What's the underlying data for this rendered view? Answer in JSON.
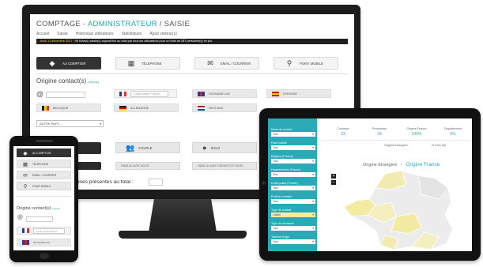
{
  "monitor": {
    "title_prefix": "COMPTAGE - ",
    "title_role": "ADMINISTRATEUR",
    "title_suffix": " / SAISIE",
    "nav": [
      "Accueil",
      "Saisie",
      "Historique utilisateurs",
      "Statistiques",
      "Ajout visiteur(s)"
    ],
    "alert_date": "Jeudi 11 décembre 2017",
    "alert_text": " : 96 fiche(s) saisie(s) aujourd'hui au total par tous les utilisateurs pour un total de 287 personne(s) en jeu.",
    "reception_buttons": [
      {
        "label": "AU COMPTOIR",
        "icon": "◆"
      },
      {
        "label": "TÉLÉPHONE",
        "icon": "▦"
      },
      {
        "label": "EMAIL / COURRIER",
        "icon": "✉"
      },
      {
        "label": "POINT MOBILE",
        "icon": "⚲"
      }
    ],
    "origin_title": "Origine contact(s)",
    "origin_hint": "(requis)",
    "code_postal_placeholder": "Code postal France...",
    "languages": [
      {
        "label": "ROYAUME-UNI",
        "colors": [
          "#1f3f8f",
          "#cf2030",
          "#1f3f8f"
        ]
      },
      {
        "label": "ESPAGNE",
        "colors": [
          "#c60b1e",
          "#ffc400",
          "#c60b1e"
        ]
      },
      {
        "label": "BELGIQUE",
        "colors": [
          "#1a1a1a",
          "#f5d100",
          "#e4302f"
        ]
      },
      {
        "label": "ALLEMAGNE",
        "colors": [
          "#1a1a1a",
          "#dd0000",
          "#ffcc00"
        ]
      },
      {
        "label": "PAYS-BAS",
        "colors": [
          "#ae1c28",
          "#ffffff",
          "#21468b"
        ]
      }
    ],
    "autre_pays": "AUTRE PAYS...",
    "group_buttons": [
      {
        "label": "COUPLE",
        "icon": "👥"
      },
      {
        "label": "SOLO",
        "icon": "●"
      }
    ],
    "captions": [
      "FAMILLE AVEC ADOS",
      "FAMILLE AVEC ENFANTS ET ADOS"
    ],
    "total_text": "onnes présentes au total :"
  },
  "phone": {
    "buttons": [
      {
        "label": "AU COMPTOIR",
        "icon": "◆"
      },
      {
        "label": "TÉLÉPHONE",
        "icon": "▦"
      },
      {
        "label": "EMAIL / COURRIER",
        "icon": "✉"
      },
      {
        "label": "POINT MOBILE",
        "icon": "⚲"
      }
    ],
    "origin_title": "Origine contact(s)",
    "origin_hint": "(requis)",
    "postal_placeholder": "Code postal France...",
    "last_label": "ROYAUME-UNI"
  },
  "tablet": {
    "filters": [
      {
        "label": "Mode de contact",
        "value": "Tout"
      },
      {
        "label": "Point mobile",
        "value": "Tout"
      },
      {
        "label": "Régions (France)",
        "value": "Tout"
      },
      {
        "label": "Départements (France)",
        "value": "Tout"
      },
      {
        "label": "Code postal (France)",
        "value": "Tout"
      },
      {
        "label": "Profil du contact",
        "value": "Tout"
      },
      {
        "label": "Type de contact",
        "value": "Loisirs"
      },
      {
        "label": "Type de demande",
        "value": "Tout"
      },
      {
        "label": "Tranche d'âge",
        "value": "Tout"
      }
    ],
    "stats": [
      {
        "label": "Contacts",
        "value": "23"
      },
      {
        "label": "Personnes",
        "value": "34"
      },
      {
        "label": "Origine France",
        "value": "100%"
      },
      {
        "label": "Département",
        "value": "0%"
      }
    ],
    "sub_stats": [
      "Origine Etrangère",
      "% hors dpt"
    ],
    "origin_left": "Origine Etrangère",
    "origin_right": "Origine France",
    "zoom": [
      "+",
      "−"
    ]
  },
  "colors": {
    "accent": "#26a3b0",
    "dark": "#2b2b2b",
    "alert_yellow": "#f3d14a"
  }
}
